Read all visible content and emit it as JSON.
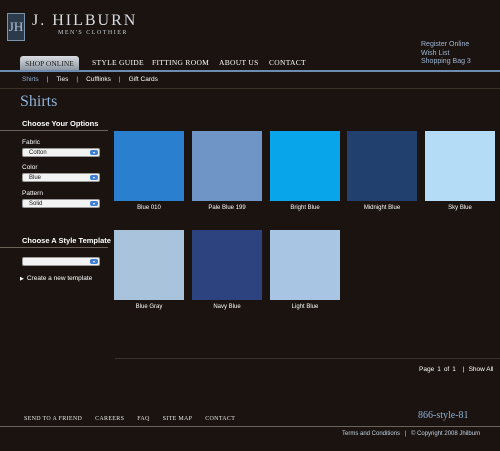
{
  "header": {
    "logo_mark": "JH",
    "brand": "J. HILBURN",
    "tagline": "MEN'S CLOTHIER",
    "account_links": [
      "Register Online",
      "Wish List",
      "Shopping Bag  3"
    ]
  },
  "nav": {
    "active": "SHOP ONLINE",
    "items": [
      "STYLE GUIDE",
      "FITTING ROOM",
      "ABOUT US",
      "CONTACT"
    ]
  },
  "subnav": {
    "items": [
      "Shirts",
      "Ties",
      "Cufflinks",
      "Gift Cards"
    ],
    "separator": "|"
  },
  "page": {
    "title": "Shirts"
  },
  "options": {
    "title": "Choose Your Options",
    "fabric": {
      "label": "Fabric",
      "value": "Cotton"
    },
    "color": {
      "label": "Color",
      "value": "Blue"
    },
    "pattern": {
      "label": "Pattern",
      "value": "Solid"
    }
  },
  "template": {
    "title": "Choose A Style Template",
    "select_value": "",
    "create_link": "Create a new template",
    "create_icon": "triangle-right-icon"
  },
  "swatches": [
    {
      "name": "Blue 010",
      "color": "#2b7fcf"
    },
    {
      "name": "Pale Blue 199",
      "color": "#6f95c6"
    },
    {
      "name": "Bright Blue",
      "color": "#08a5ea"
    },
    {
      "name": "Midnight Blue",
      "color": "#22406e"
    },
    {
      "name": "Sky Blue",
      "color": "#b4dcf6"
    },
    {
      "name": "Blue Gray",
      "color": "#a9c3dc"
    },
    {
      "name": "Navy Blue",
      "color": "#2c4380"
    },
    {
      "name": "Light Blue",
      "color": "#a8c6e4"
    }
  ],
  "pagination": {
    "label": "Page",
    "current": "1",
    "of": "of",
    "total": "1",
    "separator": "|",
    "show_all": "Show All"
  },
  "footer": {
    "links": [
      "SEND TO A FRIEND",
      "CAREERS",
      "FAQ",
      "SITE MAP",
      "CONTACT"
    ],
    "phone": "866-style-81",
    "terms": "Terms and Conditions",
    "separator": "|",
    "copyright": "© Copyright 2008 Jhilburn"
  }
}
